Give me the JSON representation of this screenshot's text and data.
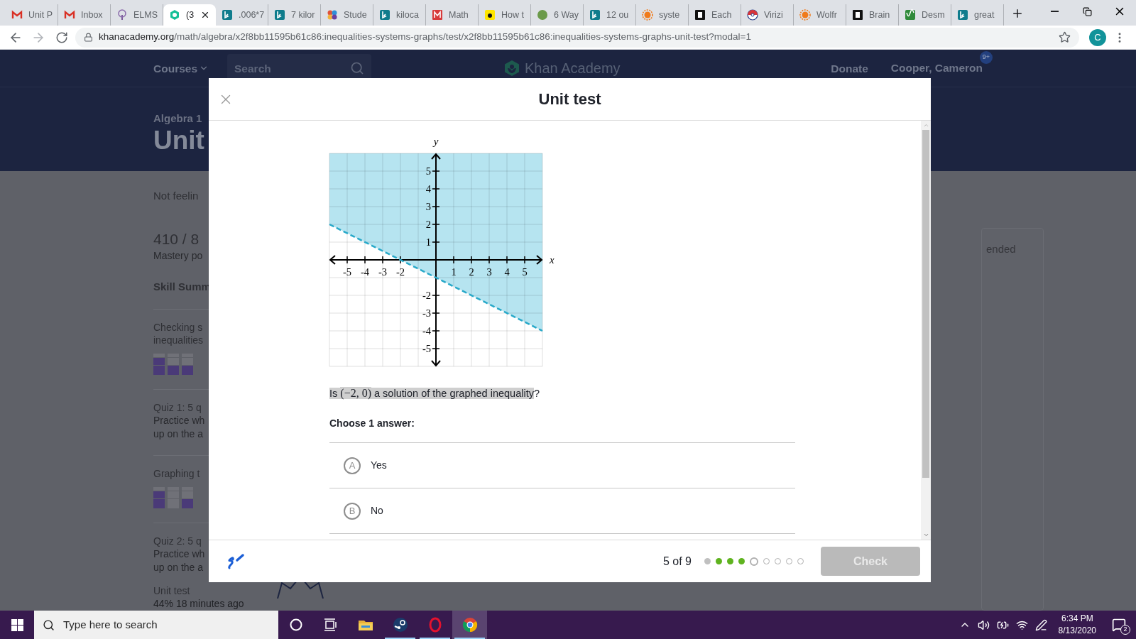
{
  "browser": {
    "tabs": [
      {
        "title": "Unit P",
        "kind": "mail",
        "selected": false
      },
      {
        "title": "Inbox",
        "kind": "mail",
        "selected": false
      },
      {
        "title": "ELMS",
        "kind": "tree",
        "selected": false
      },
      {
        "title": "(3",
        "kind": "hexagon",
        "selected": true
      },
      {
        "title": ".006*7",
        "kind": "bing",
        "selected": false
      },
      {
        "title": "7 kilor",
        "kind": "bing",
        "selected": false
      },
      {
        "title": "Stude",
        "kind": "flower",
        "selected": false
      },
      {
        "title": "kiloca",
        "kind": "bing",
        "selected": false
      },
      {
        "title": "Math",
        "kind": "mathway",
        "selected": false
      },
      {
        "title": "How t",
        "kind": "dict",
        "selected": false
      },
      {
        "title": "6 Way",
        "kind": "wh",
        "selected": false
      },
      {
        "title": "12 ou",
        "kind": "bing",
        "selected": false
      },
      {
        "title": "syste",
        "kind": "sun",
        "selected": false
      },
      {
        "title": "Each",
        "kind": "brainly",
        "selected": false
      },
      {
        "title": "Virizi",
        "kind": "ball",
        "selected": false
      },
      {
        "title": "Wolfr",
        "kind": "sun",
        "selected": false
      },
      {
        "title": "Brain",
        "kind": "brainly",
        "selected": false
      },
      {
        "title": "Desm",
        "kind": "desmos",
        "selected": false
      },
      {
        "title": "great",
        "kind": "bing",
        "selected": false
      }
    ],
    "url": {
      "domain": "khanacademy.org",
      "path": "/math/algebra/x2f8bb11595b61c86:inequalities-systems-graphs/test/x2f8bb11595b61c86:inequalities-systems-graphs-unit-test?modal=1"
    },
    "profile": "C"
  },
  "site": {
    "nav": {
      "courses": "Courses",
      "search_placeholder": "Search",
      "logo": "Khan Academy",
      "donate": "Donate",
      "user": "Cooper, Cameron",
      "badge": "9+"
    },
    "course": "Algebra 1",
    "unit": "Unit",
    "intro": "Not feelin",
    "points": "410 / 8",
    "points_label": "Mastery po",
    "summary_title": "Skill Summ",
    "items": [
      {
        "kind": "skill",
        "lines": [
          "Checking s",
          "inequalities"
        ],
        "bars": [
          {
            "kind": "full"
          },
          {
            "kind": "half"
          },
          {
            "kind": "half"
          }
        ]
      },
      {
        "kind": "quiz",
        "lines": [
          "Quiz 1: 5 q"
        ],
        "description": [
          "Practice wh",
          "up on the a"
        ]
      },
      {
        "kind": "skill",
        "lines": [
          "Graphing t"
        ],
        "bars": [
          {
            "kind": "full"
          },
          {
            "kind": "none"
          },
          {
            "kind": "half"
          }
        ]
      },
      {
        "kind": "quiz",
        "lines": [
          "Quiz 2: 5 q"
        ],
        "description": [
          "Practice wh",
          "up on the a"
        ]
      },
      {
        "kind": "test",
        "lines": [
          "Unit test"
        ],
        "description": [
          "44% 18 minutes ago"
        ]
      }
    ],
    "right_text": "ended"
  },
  "modal": {
    "title": "Unit test",
    "graph": {
      "chart_data": {
        "type": "line",
        "xlabel": "x",
        "ylabel": "y",
        "xlim": [
          -6,
          6
        ],
        "ylim": [
          -6,
          6
        ],
        "x": [
          -6,
          6
        ],
        "grid": true,
        "series": [
          {
            "color": "#29a9c9",
            "line_style": "dashed",
            "values": [
              2,
              -4
            ]
          }
        ],
        "xticks": [
          -5,
          -4,
          -3,
          -2,
          1,
          2,
          3,
          4,
          5
        ],
        "yticks": [
          -5,
          -4,
          -3,
          -2,
          1,
          2,
          3,
          4,
          5
        ]
      }
    },
    "question": [
      {
        "text": "Is ",
        "kind": "text",
        "highlighted": true
      },
      {
        "text": "(−2, 0)",
        "kind": "math",
        "highlighted": true
      },
      {
        "text": " a solution of the graphed inequality",
        "kind": "text",
        "highlighted": true
      },
      {
        "text": "?",
        "kind": "text",
        "highlighted": false
      }
    ],
    "prompt": "Choose 1 answer:",
    "choices": [
      {
        "letter": "A",
        "text": "Yes",
        "selected": false
      },
      {
        "letter": "B",
        "text": "No",
        "selected": false
      }
    ],
    "progress": {
      "label": "5 of 9",
      "steps": [
        {
          "kind": "skipped"
        },
        {
          "kind": "correct"
        },
        {
          "kind": "correct"
        },
        {
          "kind": "correct"
        },
        {
          "kind": "current"
        },
        {
          "kind": "open"
        },
        {
          "kind": "open"
        },
        {
          "kind": "open"
        },
        {
          "kind": "open"
        }
      ]
    },
    "check": {
      "label": "Check",
      "disabled": true
    }
  },
  "taskbar": {
    "search_placeholder": "Type here to search",
    "apps": [
      {
        "kind": "cortana",
        "running": false,
        "selected": false
      },
      {
        "kind": "taskview",
        "running": false,
        "selected": false
      },
      {
        "kind": "folder",
        "running": false,
        "selected": false
      },
      {
        "kind": "steam",
        "running": true,
        "selected": false
      },
      {
        "kind": "opera",
        "running": true,
        "selected": false
      },
      {
        "kind": "chrome",
        "running": true,
        "selected": true
      }
    ],
    "time": "6:34 PM",
    "date": "8/13/2020",
    "notifications": "2"
  }
}
